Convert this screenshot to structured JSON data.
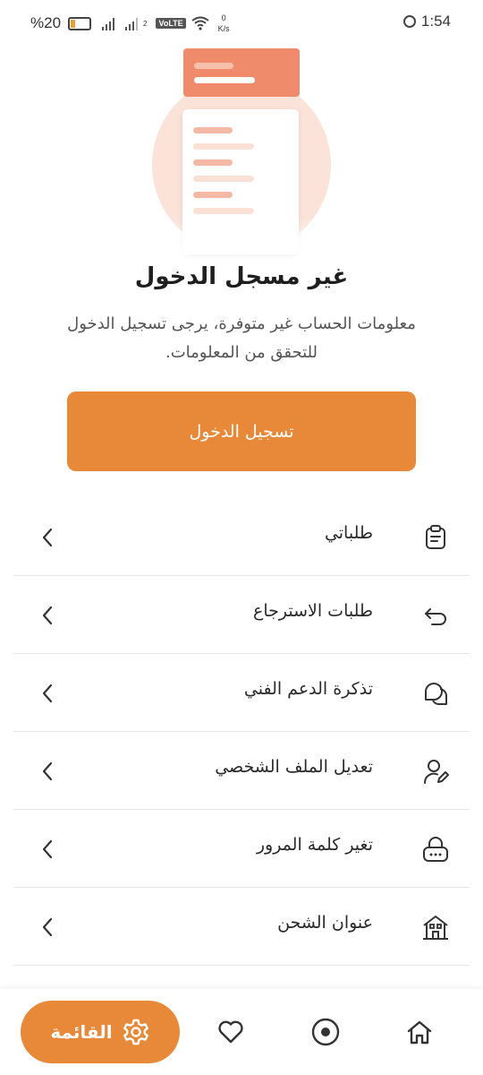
{
  "status_bar": {
    "battery": "%20",
    "network_speed_value": "0",
    "network_speed_unit": "K/s",
    "volte": "VoLTE",
    "sim2": "2",
    "time": "1:54"
  },
  "colors": {
    "accent": "#e8893a",
    "illustration_coral": "#ef8a6a",
    "illustration_bg": "#fbe3da"
  },
  "header": {
    "title": "غير مسجل الدخول",
    "message": "معلومات الحساب غير متوفرة، يرجى تسجيل الدخول للتحقق من المعلومات."
  },
  "login_button": {
    "label": "تسجيل الدخول"
  },
  "menu": {
    "items": [
      {
        "label": "طلباتي",
        "icon": "clipboard-icon"
      },
      {
        "label": "طلبات الاسترجاع",
        "icon": "return-arrow-icon"
      },
      {
        "label": "تذكرة الدعم الفني",
        "icon": "chat-bubbles-icon"
      },
      {
        "label": "تعديل الملف الشخصي",
        "icon": "user-edit-icon"
      },
      {
        "label": "تغير كلمة المرور",
        "icon": "lock-icon"
      },
      {
        "label": "عنوان الشحن",
        "icon": "house-icon"
      }
    ]
  },
  "bottom_nav": {
    "menu_label": "القائمة",
    "items": [
      {
        "icon": "gear-icon"
      },
      {
        "icon": "heart-icon"
      },
      {
        "icon": "circle-dot-icon"
      },
      {
        "icon": "home-icon"
      }
    ]
  }
}
